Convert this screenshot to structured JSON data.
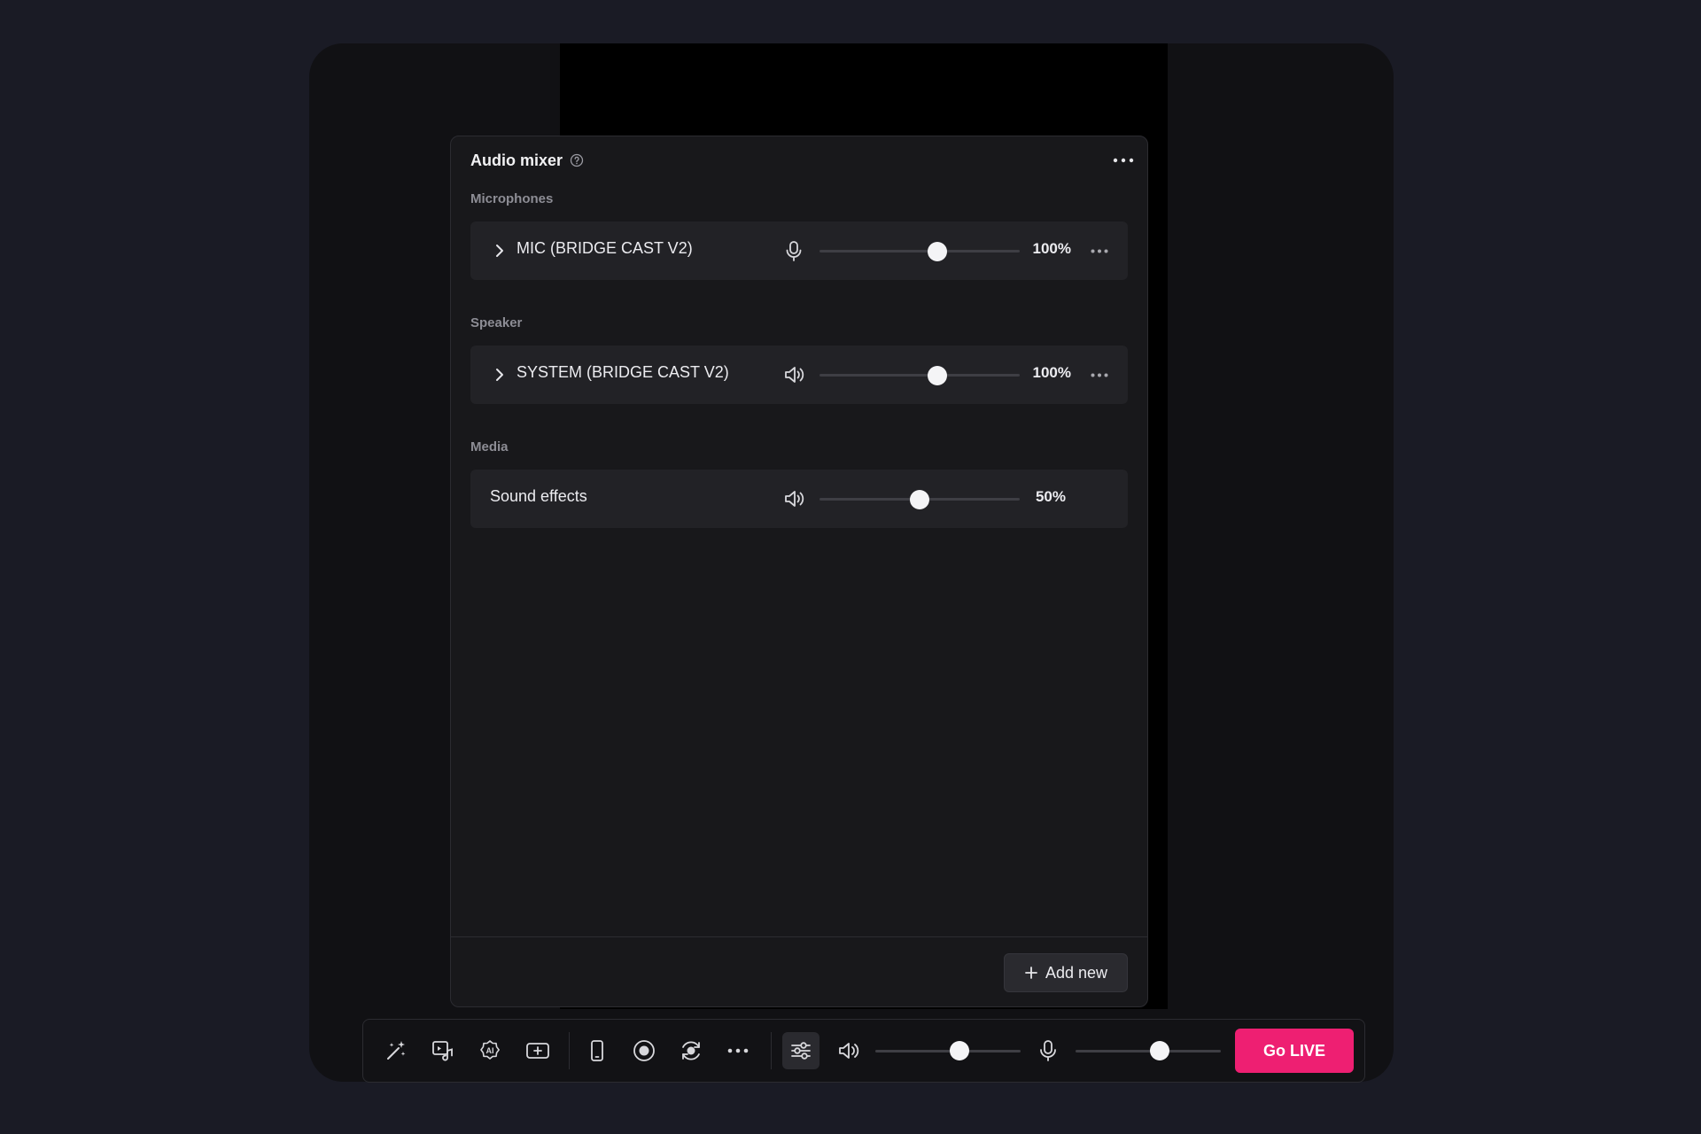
{
  "colors": {
    "background": "#1a1b25",
    "panel": "#18181b",
    "row": "#222226",
    "accent_go_live": "#ee1f72"
  },
  "mixer": {
    "title": "Audio mixer",
    "help_icon": "help-circle-icon",
    "more_icon": "more-horizontal-icon",
    "sections": [
      {
        "label": "Microphones",
        "rows": [
          {
            "name": "MIC (BRIDGE CAST V2)",
            "icon": "microphone-icon",
            "volume": 100,
            "percent_label": "100%",
            "expandable": true,
            "has_more": true
          }
        ]
      },
      {
        "label": "Speaker",
        "rows": [
          {
            "name": "SYSTEM (BRIDGE CAST V2)",
            "icon": "speaker-icon",
            "volume": 100,
            "percent_label": "100%",
            "expandable": true,
            "has_more": true
          }
        ]
      },
      {
        "label": "Media",
        "rows": [
          {
            "name": "Sound effects",
            "icon": "speaker-icon",
            "volume": 50,
            "percent_label": "50%",
            "expandable": false,
            "has_more": false
          }
        ]
      }
    ],
    "add_new_label": "Add new"
  },
  "toolbar": {
    "buttons": [
      "magic-wand-icon",
      "media-music-icon",
      "ai-badge-icon",
      "add-screen-icon",
      "phone-icon",
      "record-icon",
      "replay-icon",
      "more-horizontal-icon",
      "mixer-sliders-icon"
    ],
    "speaker_volume": 0.58,
    "mic_volume": 0.58,
    "go_live_label": "Go LIVE"
  }
}
